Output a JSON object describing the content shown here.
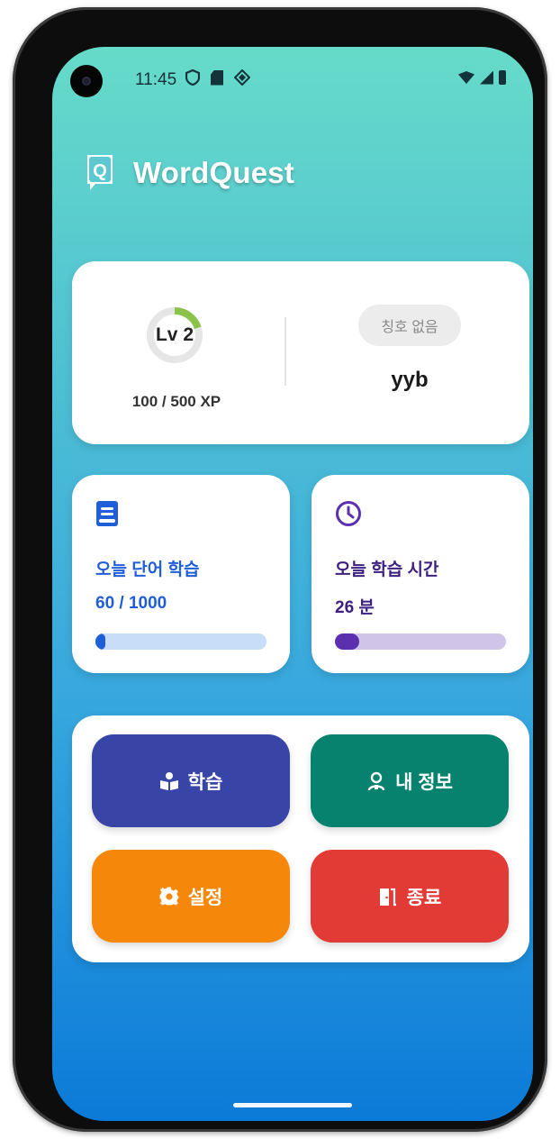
{
  "status_bar": {
    "time": "11:45",
    "left_icons": [
      "shield-icon",
      "sdcard-icon",
      "diamond-icon"
    ],
    "right_icons": [
      "wifi-icon",
      "signal-icon",
      "battery-icon"
    ]
  },
  "app": {
    "title": "WordQuest",
    "logo_letter": "Q"
  },
  "profile": {
    "level_label": "Lv 2",
    "xp_text": "100 / 500 XP",
    "xp_progress": 0.2,
    "title_chip": "칭호 없음",
    "username": "yyb"
  },
  "stats": {
    "words": {
      "label": "오늘 단어 학습",
      "value": "60 / 1000",
      "progress": 0.06,
      "accent": "#1f5ed8",
      "track": "#c7ddf8",
      "icon": "book-icon"
    },
    "time": {
      "label": "오늘 학습 시간",
      "value": "26 분",
      "progress": 0.14,
      "accent": "#5b2fb0",
      "track": "#d1c4e9",
      "icon": "clock-icon"
    }
  },
  "menu": {
    "study": "학습",
    "profile": "내 정보",
    "settings": "설정",
    "exit": "종료"
  },
  "colors": {
    "study": "#3844a6",
    "profile": "#06826e",
    "settings": "#f5880b",
    "exit": "#e23a35"
  }
}
